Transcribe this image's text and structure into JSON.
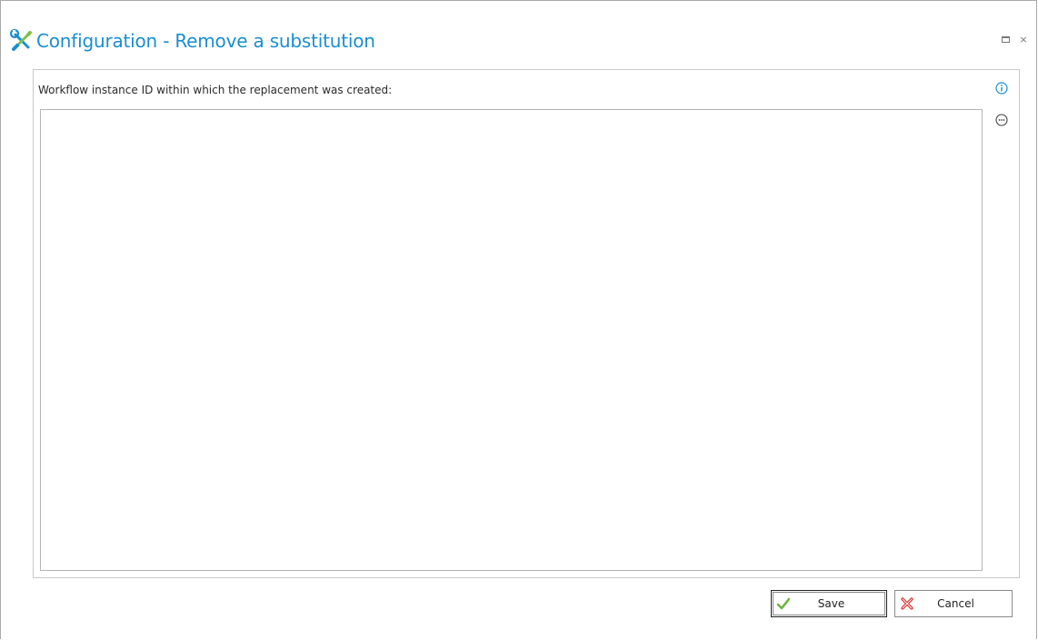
{
  "window": {
    "title": "Configuration - Remove a substitution",
    "title_icon": "tools-icon",
    "controls": {
      "maximize_icon": "maximize-icon",
      "close_glyph": "×"
    }
  },
  "form": {
    "label": "Workflow instance ID within which the replacement was created:",
    "value": "",
    "info_icon": "info-icon",
    "more_icon": "ellipsis-icon"
  },
  "buttons": {
    "save_label": "Save",
    "cancel_label": "Cancel"
  },
  "colors": {
    "accent": "#1a8ed2",
    "save_check": "#6db33f",
    "cancel_x": "#d42a2a"
  }
}
